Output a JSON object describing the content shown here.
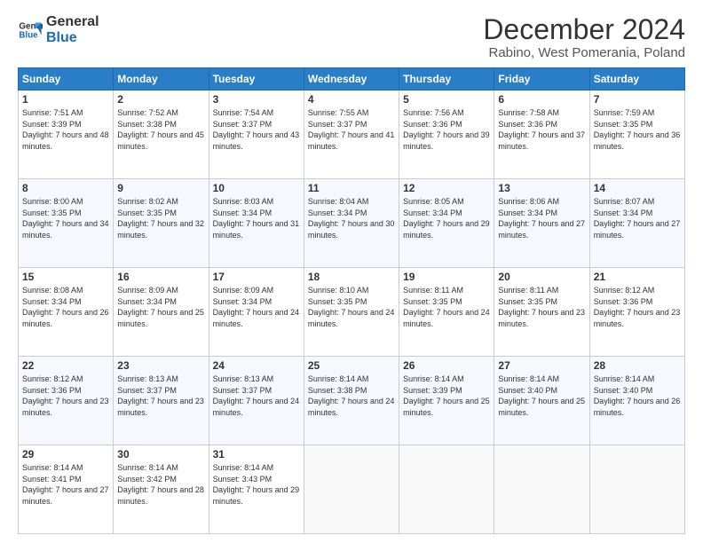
{
  "logo": {
    "line1": "General",
    "line2": "Blue"
  },
  "title": "December 2024",
  "subtitle": "Rabino, West Pomerania, Poland",
  "days_header": [
    "Sunday",
    "Monday",
    "Tuesday",
    "Wednesday",
    "Thursday",
    "Friday",
    "Saturday"
  ],
  "weeks": [
    [
      {
        "day": "1",
        "sunrise": "7:51 AM",
        "sunset": "3:39 PM",
        "daylight": "7 hours and 48 minutes."
      },
      {
        "day": "2",
        "sunrise": "7:52 AM",
        "sunset": "3:38 PM",
        "daylight": "7 hours and 45 minutes."
      },
      {
        "day": "3",
        "sunrise": "7:54 AM",
        "sunset": "3:37 PM",
        "daylight": "7 hours and 43 minutes."
      },
      {
        "day": "4",
        "sunrise": "7:55 AM",
        "sunset": "3:37 PM",
        "daylight": "7 hours and 41 minutes."
      },
      {
        "day": "5",
        "sunrise": "7:56 AM",
        "sunset": "3:36 PM",
        "daylight": "7 hours and 39 minutes."
      },
      {
        "day": "6",
        "sunrise": "7:58 AM",
        "sunset": "3:36 PM",
        "daylight": "7 hours and 37 minutes."
      },
      {
        "day": "7",
        "sunrise": "7:59 AM",
        "sunset": "3:35 PM",
        "daylight": "7 hours and 36 minutes."
      }
    ],
    [
      {
        "day": "8",
        "sunrise": "8:00 AM",
        "sunset": "3:35 PM",
        "daylight": "7 hours and 34 minutes."
      },
      {
        "day": "9",
        "sunrise": "8:02 AM",
        "sunset": "3:35 PM",
        "daylight": "7 hours and 32 minutes."
      },
      {
        "day": "10",
        "sunrise": "8:03 AM",
        "sunset": "3:34 PM",
        "daylight": "7 hours and 31 minutes."
      },
      {
        "day": "11",
        "sunrise": "8:04 AM",
        "sunset": "3:34 PM",
        "daylight": "7 hours and 30 minutes."
      },
      {
        "day": "12",
        "sunrise": "8:05 AM",
        "sunset": "3:34 PM",
        "daylight": "7 hours and 29 minutes."
      },
      {
        "day": "13",
        "sunrise": "8:06 AM",
        "sunset": "3:34 PM",
        "daylight": "7 hours and 27 minutes."
      },
      {
        "day": "14",
        "sunrise": "8:07 AM",
        "sunset": "3:34 PM",
        "daylight": "7 hours and 27 minutes."
      }
    ],
    [
      {
        "day": "15",
        "sunrise": "8:08 AM",
        "sunset": "3:34 PM",
        "daylight": "7 hours and 26 minutes."
      },
      {
        "day": "16",
        "sunrise": "8:09 AM",
        "sunset": "3:34 PM",
        "daylight": "7 hours and 25 minutes."
      },
      {
        "day": "17",
        "sunrise": "8:09 AM",
        "sunset": "3:34 PM",
        "daylight": "7 hours and 24 minutes."
      },
      {
        "day": "18",
        "sunrise": "8:10 AM",
        "sunset": "3:35 PM",
        "daylight": "7 hours and 24 minutes."
      },
      {
        "day": "19",
        "sunrise": "8:11 AM",
        "sunset": "3:35 PM",
        "daylight": "7 hours and 24 minutes."
      },
      {
        "day": "20",
        "sunrise": "8:11 AM",
        "sunset": "3:35 PM",
        "daylight": "7 hours and 23 minutes."
      },
      {
        "day": "21",
        "sunrise": "8:12 AM",
        "sunset": "3:36 PM",
        "daylight": "7 hours and 23 minutes."
      }
    ],
    [
      {
        "day": "22",
        "sunrise": "8:12 AM",
        "sunset": "3:36 PM",
        "daylight": "7 hours and 23 minutes."
      },
      {
        "day": "23",
        "sunrise": "8:13 AM",
        "sunset": "3:37 PM",
        "daylight": "7 hours and 23 minutes."
      },
      {
        "day": "24",
        "sunrise": "8:13 AM",
        "sunset": "3:37 PM",
        "daylight": "7 hours and 24 minutes."
      },
      {
        "day": "25",
        "sunrise": "8:14 AM",
        "sunset": "3:38 PM",
        "daylight": "7 hours and 24 minutes."
      },
      {
        "day": "26",
        "sunrise": "8:14 AM",
        "sunset": "3:39 PM",
        "daylight": "7 hours and 25 minutes."
      },
      {
        "day": "27",
        "sunrise": "8:14 AM",
        "sunset": "3:40 PM",
        "daylight": "7 hours and 25 minutes."
      },
      {
        "day": "28",
        "sunrise": "8:14 AM",
        "sunset": "3:40 PM",
        "daylight": "7 hours and 26 minutes."
      }
    ],
    [
      {
        "day": "29",
        "sunrise": "8:14 AM",
        "sunset": "3:41 PM",
        "daylight": "7 hours and 27 minutes."
      },
      {
        "day": "30",
        "sunrise": "8:14 AM",
        "sunset": "3:42 PM",
        "daylight": "7 hours and 28 minutes."
      },
      {
        "day": "31",
        "sunrise": "8:14 AM",
        "sunset": "3:43 PM",
        "daylight": "7 hours and 29 minutes."
      },
      null,
      null,
      null,
      null
    ]
  ]
}
